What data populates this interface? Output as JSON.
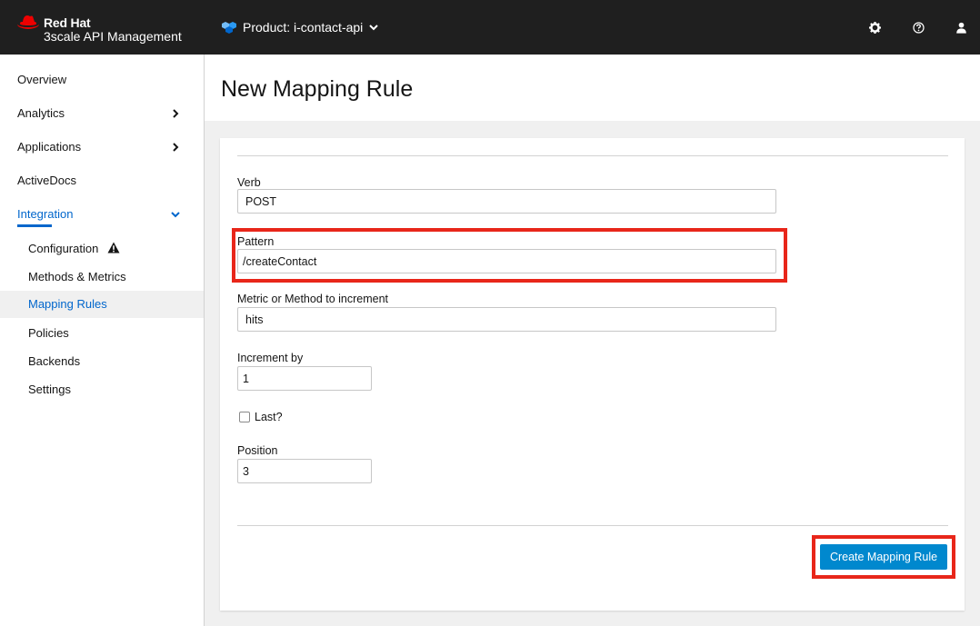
{
  "header": {
    "brand": "Red Hat",
    "product_line": "3scale API Management",
    "product_selector": "Product: i-contact-api",
    "icons": [
      "settings-gear-icon",
      "help-question-icon",
      "user-account-icon"
    ],
    "background": "#1f1f1f",
    "brand_color": "#ee0000"
  },
  "sidebar": {
    "items": [
      {
        "label": "Overview",
        "has_chevron": false
      },
      {
        "label": "Analytics",
        "has_chevron": true
      },
      {
        "label": "Applications",
        "has_chevron": true
      },
      {
        "label": "ActiveDocs",
        "has_chevron": false
      },
      {
        "label": "Integration",
        "has_chevron": true,
        "expanded": true,
        "active": true
      }
    ],
    "sub_items": [
      {
        "label": "Configuration",
        "warning_icon": true
      },
      {
        "label": "Methods & Metrics"
      },
      {
        "label": "Mapping Rules",
        "current": true
      },
      {
        "label": "Policies"
      },
      {
        "label": "Backends"
      },
      {
        "label": "Settings"
      }
    ],
    "active_color": "#0066cc"
  },
  "page": {
    "title": "New Mapping Rule"
  },
  "form": {
    "verb": {
      "label": "Verb",
      "value": "POST"
    },
    "pattern": {
      "label": "Pattern",
      "value": "/createContact",
      "highlighted": true
    },
    "metric": {
      "label": "Metric or Method to increment",
      "value": "hits"
    },
    "increment": {
      "label": "Increment by",
      "value": "1"
    },
    "last": {
      "label": "Last?",
      "checked": false
    },
    "position": {
      "label": "Position",
      "value": "3"
    },
    "submit": {
      "label": "Create Mapping Rule",
      "highlighted": true,
      "color": "#0088ce"
    },
    "highlight_color": "#e8261a"
  }
}
